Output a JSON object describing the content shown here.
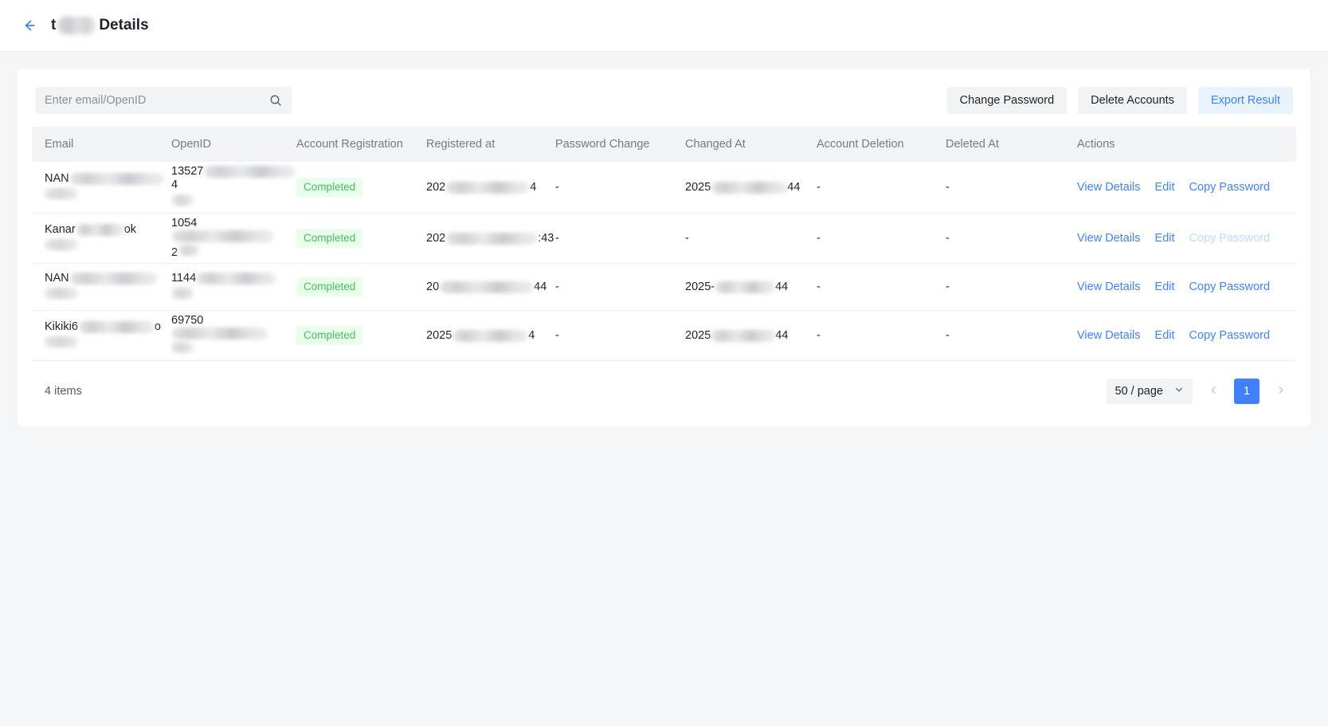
{
  "header": {
    "back_icon": "arrow-left-icon",
    "redacted_prefix": "t",
    "title": "Details"
  },
  "toolbar": {
    "search": {
      "value": "",
      "placeholder": "Enter email/OpenID",
      "icon": "search-icon"
    },
    "buttons": [
      {
        "label": "Change Password",
        "style": "default"
      },
      {
        "label": "Delete Accounts",
        "style": "default"
      },
      {
        "label": "Export Result",
        "style": "primary-soft"
      }
    ]
  },
  "table": {
    "columns": [
      "Email",
      "OpenID",
      "Account Registration",
      "Registered at",
      "Password Change",
      "Changed At",
      "Account Deletion",
      "Deleted At",
      "Actions"
    ],
    "rows": [
      {
        "email_prefix": "NAN",
        "openid_prefix": "13527",
        "openid_suffix": "4",
        "openid_second_line": "",
        "registration": "Completed",
        "registered_at_prefix": "202",
        "registered_at_suffix": "4",
        "password_change": "-",
        "changed_at_prefix": "2025",
        "changed_at_suffix": "44",
        "account_deletion": "-",
        "deleted_at": "-",
        "actions": {
          "view": "View Details",
          "edit": "Edit",
          "copy": "Copy Password",
          "copy_disabled": false
        }
      },
      {
        "email_prefix": "Kanar",
        "email_suffix": "ok",
        "openid_prefix": "1054",
        "openid_suffix": "",
        "openid_second_line": "2",
        "registration": "Completed",
        "registered_at_prefix": "202",
        "registered_at_suffix": ":43",
        "password_change": "-",
        "changed_at_prefix": "-",
        "changed_at_suffix": "",
        "account_deletion": "-",
        "deleted_at": "-",
        "actions": {
          "view": "View Details",
          "edit": "Edit",
          "copy": "Copy Password",
          "copy_disabled": true
        }
      },
      {
        "email_prefix": "NAN",
        "openid_prefix": "1144",
        "openid_suffix": "",
        "openid_second_line": "",
        "registration": "Completed",
        "registered_at_prefix": "20",
        "registered_at_suffix": "44",
        "password_change": "-",
        "changed_at_prefix": "2025-",
        "changed_at_suffix": "44",
        "account_deletion": "-",
        "deleted_at": "-",
        "actions": {
          "view": "View Details",
          "edit": "Edit",
          "copy": "Copy Password",
          "copy_disabled": false
        }
      },
      {
        "email_prefix": "Kikiki6",
        "email_suffix": "o",
        "openid_prefix": "69750",
        "openid_suffix": "",
        "openid_second_line": "",
        "registration": "Completed",
        "registered_at_prefix": "2025",
        "registered_at_suffix": "4",
        "password_change": "-",
        "changed_at_prefix": "2025",
        "changed_at_suffix": "44",
        "account_deletion": "-",
        "deleted_at": "-",
        "actions": {
          "view": "View Details",
          "edit": "Edit",
          "copy": "Copy Password",
          "copy_disabled": false
        }
      }
    ]
  },
  "footer": {
    "items_count": "4 items",
    "page_size": "50 / page",
    "page_size_icon": "chevron-down-icon",
    "prev_icon": "chevron-left-icon",
    "next_icon": "chevron-right-icon",
    "current_page": "1"
  },
  "colors": {
    "accent_blue": "#4080ff",
    "soft_blue_bg": "#e8f3ff",
    "badge_green_bg": "#e8ffea",
    "badge_green_text": "#4cb964",
    "header_bg": "#f2f3f5",
    "page_bg": "#f4f5f7"
  }
}
